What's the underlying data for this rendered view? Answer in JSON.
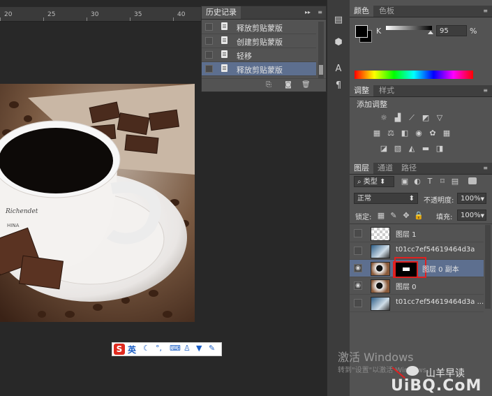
{
  "ruler": {
    "ticks": [
      "20",
      "25",
      "30",
      "35",
      "40"
    ]
  },
  "history_panel": {
    "tabs": [
      "历史记录"
    ],
    "items": [
      {
        "label": "释放剪贴蒙版",
        "selected": false
      },
      {
        "label": "创建剪贴蒙版",
        "selected": false
      },
      {
        "label": "轻移",
        "selected": false
      },
      {
        "label": "释放剪贴蒙版",
        "selected": true
      }
    ],
    "footer_icons": [
      "new-document-from-state-icon",
      "camera-snapshot-icon",
      "trash-icon"
    ]
  },
  "tool_column": {
    "icons": [
      "history-icon",
      "3d-cube-icon",
      "character-icon",
      "paragraph-icon"
    ],
    "labels": [
      "A",
      "¶"
    ]
  },
  "color_panel": {
    "tabs": [
      "颜色",
      "色板"
    ],
    "channel_label": "K",
    "channel_value": "95",
    "unit": "%",
    "foreground_color": "#000000",
    "background_color": "#000000"
  },
  "adjustments_panel": {
    "tabs": [
      "调整",
      "样式"
    ],
    "title": "添加调整"
  },
  "layers_panel": {
    "tabs": [
      "图层",
      "通道",
      "路径"
    ],
    "filter_label": "类型",
    "blend_mode": "正常",
    "opacity_label": "不透明度:",
    "opacity_value": "100%",
    "lock_label": "锁定:",
    "fill_label": "填充:",
    "fill_value": "100%",
    "layers": [
      {
        "name": "图层 1",
        "visible": false,
        "selected": false,
        "thumb": "transparent"
      },
      {
        "name": "t01cc7ef54619464d3a",
        "visible": false,
        "selected": false,
        "thumb": "photo"
      },
      {
        "name": "图层 0 副本",
        "visible": true,
        "selected": true,
        "thumb": "coffee",
        "has_mask": true
      },
      {
        "name": "图层 0",
        "visible": true,
        "selected": false,
        "thumb": "coffee"
      },
      {
        "name": "t01cc7ef54619464d3a ...",
        "visible": false,
        "selected": false,
        "thumb": "photo"
      }
    ]
  },
  "ime_toolbar": {
    "logo": "S",
    "mode": "英",
    "icons": [
      "moon-icon",
      "punctuation-icon",
      "keyboard-icon",
      "person-icon",
      "shirt-icon",
      "wrench-icon"
    ]
  },
  "watermark": {
    "activate_title": "激活 Windows",
    "activate_sub": "转到\"设置\"以激活 Windows。",
    "brand": "山羊早读",
    "site": "UiBQ.CoM"
  },
  "colors": {
    "panel": "#535353",
    "selection": "#5d6f8f",
    "dark": "#282828"
  }
}
